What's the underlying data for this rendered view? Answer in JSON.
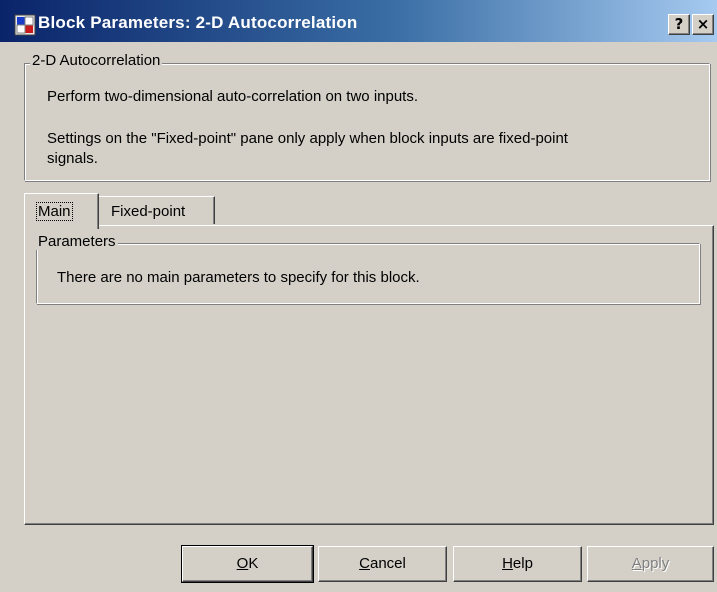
{
  "window": {
    "title": "Block Parameters: 2-D Autocorrelation",
    "help_glyph": "?",
    "close_glyph": "×"
  },
  "description": {
    "group_label": "2-D Autocorrelation",
    "line1": "Perform two-dimensional auto-correlation on two inputs.",
    "line2": "Settings on the \"Fixed-point\" pane only apply when block inputs are fixed-point",
    "line3": "signals."
  },
  "tabs": [
    {
      "label": "Main",
      "active": true
    },
    {
      "label": "Fixed-point",
      "active": false
    }
  ],
  "parameters": {
    "group_label": "Parameters",
    "message": "There are no main parameters to specify for this block."
  },
  "buttons": {
    "ok": {
      "mnemonic": "O",
      "rest": "K"
    },
    "cancel": {
      "mnemonic": "C",
      "rest": "ancel"
    },
    "help": {
      "mnemonic": "H",
      "rest": "elp"
    },
    "apply": {
      "mnemonic": "A",
      "rest": "pply",
      "enabled": false
    }
  }
}
